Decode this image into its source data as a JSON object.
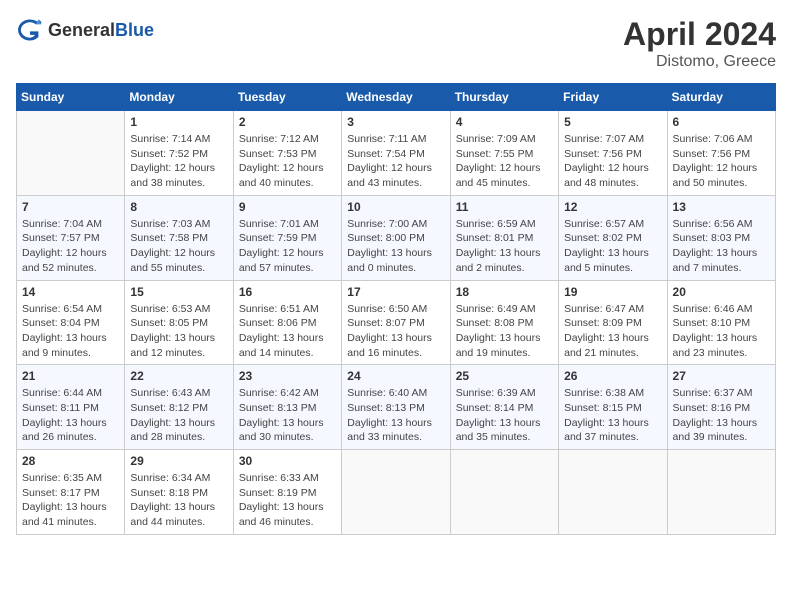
{
  "header": {
    "logo_general": "General",
    "logo_blue": "Blue",
    "month": "April 2024",
    "location": "Distomo, Greece"
  },
  "weekdays": [
    "Sunday",
    "Monday",
    "Tuesday",
    "Wednesday",
    "Thursday",
    "Friday",
    "Saturday"
  ],
  "weeks": [
    [
      {
        "day": "",
        "sunrise": "",
        "sunset": "",
        "daylight": ""
      },
      {
        "day": "1",
        "sunrise": "Sunrise: 7:14 AM",
        "sunset": "Sunset: 7:52 PM",
        "daylight": "Daylight: 12 hours and 38 minutes."
      },
      {
        "day": "2",
        "sunrise": "Sunrise: 7:12 AM",
        "sunset": "Sunset: 7:53 PM",
        "daylight": "Daylight: 12 hours and 40 minutes."
      },
      {
        "day": "3",
        "sunrise": "Sunrise: 7:11 AM",
        "sunset": "Sunset: 7:54 PM",
        "daylight": "Daylight: 12 hours and 43 minutes."
      },
      {
        "day": "4",
        "sunrise": "Sunrise: 7:09 AM",
        "sunset": "Sunset: 7:55 PM",
        "daylight": "Daylight: 12 hours and 45 minutes."
      },
      {
        "day": "5",
        "sunrise": "Sunrise: 7:07 AM",
        "sunset": "Sunset: 7:56 PM",
        "daylight": "Daylight: 12 hours and 48 minutes."
      },
      {
        "day": "6",
        "sunrise": "Sunrise: 7:06 AM",
        "sunset": "Sunset: 7:56 PM",
        "daylight": "Daylight: 12 hours and 50 minutes."
      }
    ],
    [
      {
        "day": "7",
        "sunrise": "Sunrise: 7:04 AM",
        "sunset": "Sunset: 7:57 PM",
        "daylight": "Daylight: 12 hours and 52 minutes."
      },
      {
        "day": "8",
        "sunrise": "Sunrise: 7:03 AM",
        "sunset": "Sunset: 7:58 PM",
        "daylight": "Daylight: 12 hours and 55 minutes."
      },
      {
        "day": "9",
        "sunrise": "Sunrise: 7:01 AM",
        "sunset": "Sunset: 7:59 PM",
        "daylight": "Daylight: 12 hours and 57 minutes."
      },
      {
        "day": "10",
        "sunrise": "Sunrise: 7:00 AM",
        "sunset": "Sunset: 8:00 PM",
        "daylight": "Daylight: 13 hours and 0 minutes."
      },
      {
        "day": "11",
        "sunrise": "Sunrise: 6:59 AM",
        "sunset": "Sunset: 8:01 PM",
        "daylight": "Daylight: 13 hours and 2 minutes."
      },
      {
        "day": "12",
        "sunrise": "Sunrise: 6:57 AM",
        "sunset": "Sunset: 8:02 PM",
        "daylight": "Daylight: 13 hours and 5 minutes."
      },
      {
        "day": "13",
        "sunrise": "Sunrise: 6:56 AM",
        "sunset": "Sunset: 8:03 PM",
        "daylight": "Daylight: 13 hours and 7 minutes."
      }
    ],
    [
      {
        "day": "14",
        "sunrise": "Sunrise: 6:54 AM",
        "sunset": "Sunset: 8:04 PM",
        "daylight": "Daylight: 13 hours and 9 minutes."
      },
      {
        "day": "15",
        "sunrise": "Sunrise: 6:53 AM",
        "sunset": "Sunset: 8:05 PM",
        "daylight": "Daylight: 13 hours and 12 minutes."
      },
      {
        "day": "16",
        "sunrise": "Sunrise: 6:51 AM",
        "sunset": "Sunset: 8:06 PM",
        "daylight": "Daylight: 13 hours and 14 minutes."
      },
      {
        "day": "17",
        "sunrise": "Sunrise: 6:50 AM",
        "sunset": "Sunset: 8:07 PM",
        "daylight": "Daylight: 13 hours and 16 minutes."
      },
      {
        "day": "18",
        "sunrise": "Sunrise: 6:49 AM",
        "sunset": "Sunset: 8:08 PM",
        "daylight": "Daylight: 13 hours and 19 minutes."
      },
      {
        "day": "19",
        "sunrise": "Sunrise: 6:47 AM",
        "sunset": "Sunset: 8:09 PM",
        "daylight": "Daylight: 13 hours and 21 minutes."
      },
      {
        "day": "20",
        "sunrise": "Sunrise: 6:46 AM",
        "sunset": "Sunset: 8:10 PM",
        "daylight": "Daylight: 13 hours and 23 minutes."
      }
    ],
    [
      {
        "day": "21",
        "sunrise": "Sunrise: 6:44 AM",
        "sunset": "Sunset: 8:11 PM",
        "daylight": "Daylight: 13 hours and 26 minutes."
      },
      {
        "day": "22",
        "sunrise": "Sunrise: 6:43 AM",
        "sunset": "Sunset: 8:12 PM",
        "daylight": "Daylight: 13 hours and 28 minutes."
      },
      {
        "day": "23",
        "sunrise": "Sunrise: 6:42 AM",
        "sunset": "Sunset: 8:13 PM",
        "daylight": "Daylight: 13 hours and 30 minutes."
      },
      {
        "day": "24",
        "sunrise": "Sunrise: 6:40 AM",
        "sunset": "Sunset: 8:13 PM",
        "daylight": "Daylight: 13 hours and 33 minutes."
      },
      {
        "day": "25",
        "sunrise": "Sunrise: 6:39 AM",
        "sunset": "Sunset: 8:14 PM",
        "daylight": "Daylight: 13 hours and 35 minutes."
      },
      {
        "day": "26",
        "sunrise": "Sunrise: 6:38 AM",
        "sunset": "Sunset: 8:15 PM",
        "daylight": "Daylight: 13 hours and 37 minutes."
      },
      {
        "day": "27",
        "sunrise": "Sunrise: 6:37 AM",
        "sunset": "Sunset: 8:16 PM",
        "daylight": "Daylight: 13 hours and 39 minutes."
      }
    ],
    [
      {
        "day": "28",
        "sunrise": "Sunrise: 6:35 AM",
        "sunset": "Sunset: 8:17 PM",
        "daylight": "Daylight: 13 hours and 41 minutes."
      },
      {
        "day": "29",
        "sunrise": "Sunrise: 6:34 AM",
        "sunset": "Sunset: 8:18 PM",
        "daylight": "Daylight: 13 hours and 44 minutes."
      },
      {
        "day": "30",
        "sunrise": "Sunrise: 6:33 AM",
        "sunset": "Sunset: 8:19 PM",
        "daylight": "Daylight: 13 hours and 46 minutes."
      },
      {
        "day": "",
        "sunrise": "",
        "sunset": "",
        "daylight": ""
      },
      {
        "day": "",
        "sunrise": "",
        "sunset": "",
        "daylight": ""
      },
      {
        "day": "",
        "sunrise": "",
        "sunset": "",
        "daylight": ""
      },
      {
        "day": "",
        "sunrise": "",
        "sunset": "",
        "daylight": ""
      }
    ]
  ]
}
